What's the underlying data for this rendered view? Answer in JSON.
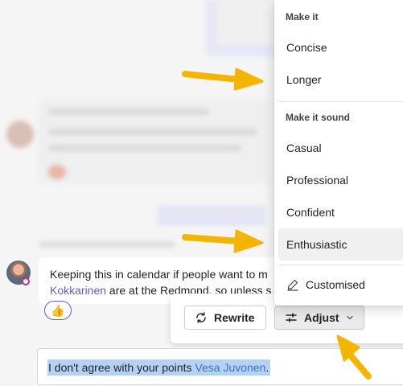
{
  "message": {
    "text_line1": "Keeping this in calendar if people want to m",
    "mention_line2": "Kokkarinen",
    "text_line2": " are at the Redmond, so unless s",
    "reaction_emoji": "👍"
  },
  "toolbar": {
    "rewrite_label": "Rewrite",
    "adjust_label": "Adjust"
  },
  "compose": {
    "text": "I don't agree with your points ",
    "mention": "Vesa Juvonen",
    "suffix": "."
  },
  "menu": {
    "section1_header": "Make it",
    "section1_items": [
      "Concise",
      "Longer"
    ],
    "section2_header": "Make it sound",
    "section2_items": [
      "Casual",
      "Professional",
      "Confident",
      "Enthusiastic"
    ],
    "custom_label": "Customised"
  },
  "colors": {
    "accent": "#5b5fc7",
    "arrow": "#f5b400",
    "highlight": "#b5d2f5"
  },
  "icons": [
    "rewrite-icon",
    "sliders-icon",
    "chevron-down-icon",
    "pencil-icon",
    "thumbs-up-icon"
  ]
}
